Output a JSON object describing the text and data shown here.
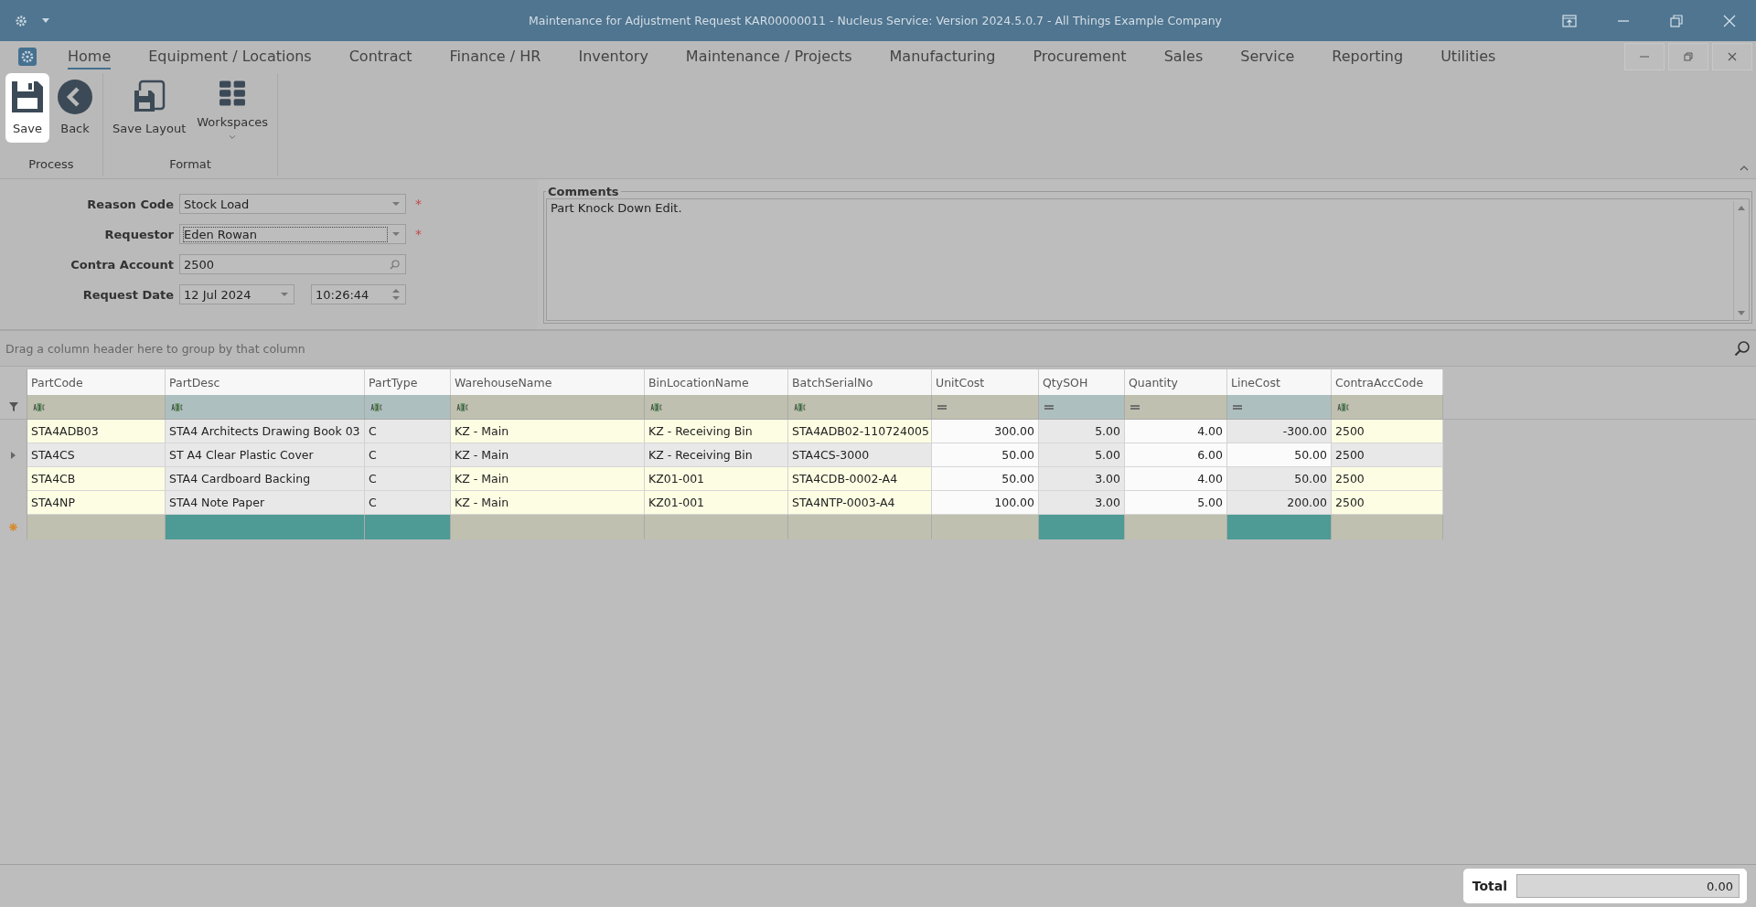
{
  "window": {
    "title": "Maintenance for Adjustment Request KAR00000011 - Nucleus Service: Version 2024.5.0.7 - All Things Example Company"
  },
  "menu_tabs": [
    {
      "label": "Home",
      "selected": true
    },
    {
      "label": "Equipment / Locations",
      "selected": false
    },
    {
      "label": "Contract",
      "selected": false
    },
    {
      "label": "Finance / HR",
      "selected": false
    },
    {
      "label": "Inventory",
      "selected": false
    },
    {
      "label": "Maintenance / Projects",
      "selected": false
    },
    {
      "label": "Manufacturing",
      "selected": false
    },
    {
      "label": "Procurement",
      "selected": false
    },
    {
      "label": "Sales",
      "selected": false
    },
    {
      "label": "Service",
      "selected": false
    },
    {
      "label": "Reporting",
      "selected": false
    },
    {
      "label": "Utilities",
      "selected": false
    }
  ],
  "ribbon": {
    "groups": [
      {
        "label": "Process",
        "buttons": [
          {
            "label": "Save",
            "kind": "save",
            "highlighted": true
          },
          {
            "label": "Back",
            "kind": "back",
            "highlighted": false
          }
        ]
      },
      {
        "label": "Format",
        "buttons": [
          {
            "label": "Save Layout",
            "kind": "save-layout",
            "highlighted": false
          },
          {
            "label": "Workspaces",
            "kind": "workspaces",
            "highlighted": false
          }
        ]
      }
    ]
  },
  "form": {
    "fields": [
      {
        "label": "Reason Code",
        "value": "Stock Load",
        "kind": "dropdown",
        "required_mark": "*",
        "focused": false
      },
      {
        "label": "Requestor",
        "value": "Eden Rowan",
        "kind": "dropdown",
        "required_mark": "*",
        "focused": true
      },
      {
        "label": "Contra Account",
        "value": "2500",
        "kind": "lookup",
        "focused": false
      },
      {
        "label": "Request Date",
        "value": "12 Jul 2024",
        "time": "10:26:44",
        "kind": "datetime",
        "focused": false
      }
    ]
  },
  "comments": {
    "label": "Comments",
    "value": "Part Knock Down Edit."
  },
  "grid": {
    "group_panel_hint": "Drag a column header here to group by that column",
    "columns": [
      {
        "label": "PartCode",
        "kind": "text",
        "readonly": false
      },
      {
        "label": "PartDesc",
        "kind": "text",
        "readonly": true
      },
      {
        "label": "PartType",
        "kind": "text",
        "readonly": true
      },
      {
        "label": "WarehouseName",
        "kind": "text",
        "readonly": false
      },
      {
        "label": "BinLocationName",
        "kind": "text",
        "readonly": false
      },
      {
        "label": "BatchSerialNo",
        "kind": "text",
        "readonly": false
      },
      {
        "label": "UnitCost",
        "kind": "number",
        "readonly": false
      },
      {
        "label": "QtySOH",
        "kind": "number",
        "readonly": true
      },
      {
        "label": "Quantity",
        "kind": "number",
        "readonly": false
      },
      {
        "label": "LineCost",
        "kind": "number",
        "readonly": true
      },
      {
        "label": "ContraAccCode",
        "kind": "text",
        "readonly": false
      }
    ],
    "rows": [
      {
        "selected": false,
        "cells": [
          "STA4ADB03",
          "STA4 Architects Drawing Book 03",
          "C",
          "KZ - Main",
          "KZ - Receiving Bin",
          "STA4ADB02-110724005",
          "300.00",
          "5.00",
          "4.00",
          "-300.00",
          "2500"
        ]
      },
      {
        "selected": true,
        "cells": [
          "STA4CS",
          "ST A4 Clear Plastic Cover",
          "C",
          "KZ - Main",
          "KZ - Receiving Bin",
          "STA4CS-3000",
          "50.00",
          "5.00",
          "6.00",
          "50.00",
          "2500"
        ]
      },
      {
        "selected": false,
        "cells": [
          "STA4CB",
          "STA4 Cardboard Backing",
          "C",
          "KZ - Main",
          "KZ01-001",
          "STA4CDB-0002-A4",
          "50.00",
          "3.00",
          "4.00",
          "50.00",
          "2500"
        ]
      },
      {
        "selected": false,
        "cells": [
          "STA4NP",
          "STA4 Note Paper",
          "C",
          "KZ - Main",
          "KZ01-001",
          "STA4NTP-0003-A4",
          "100.00",
          "3.00",
          "5.00",
          "200.00",
          "2500"
        ]
      }
    ]
  },
  "total": {
    "label": "Total",
    "value": "0.00",
    "highlighted": true
  }
}
